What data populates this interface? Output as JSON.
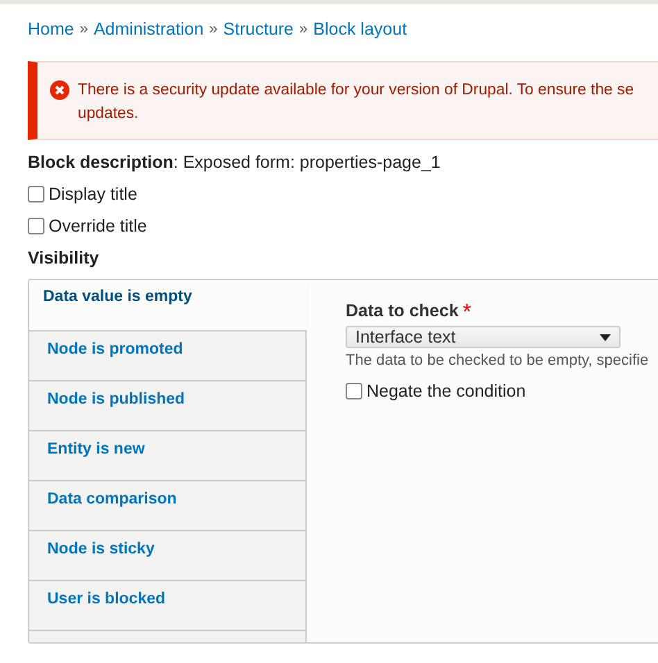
{
  "breadcrumb": [
    "Home",
    "Administration",
    "Structure",
    "Block layout"
  ],
  "breadcrumb_separator": "»",
  "alert": {
    "lines": [
      "There is a security update available for your version of Drupal. To ensure the se",
      "updates."
    ]
  },
  "block_description": {
    "label": "Block description",
    "value": ": Exposed form: properties-page_1"
  },
  "checkboxes": [
    {
      "label": "Display title",
      "checked": false
    },
    {
      "label": "Override title",
      "checked": false
    }
  ],
  "visibility": {
    "heading": "Visibility",
    "tabs": [
      {
        "label": "Data value is empty",
        "selected": true
      },
      {
        "label": "Node is promoted",
        "selected": false
      },
      {
        "label": "Node is published",
        "selected": false
      },
      {
        "label": "Entity is new",
        "selected": false
      },
      {
        "label": "Data comparison",
        "selected": false
      },
      {
        "label": "Node is sticky",
        "selected": false
      },
      {
        "label": "User is blocked",
        "selected": false
      }
    ],
    "pane": {
      "field_label": "Data to check",
      "required_mark": "*",
      "select_value": "Interface text",
      "help": "The data to be checked to be empty, specifie",
      "negate": {
        "label": "Negate the condition",
        "checked": false
      }
    }
  }
}
